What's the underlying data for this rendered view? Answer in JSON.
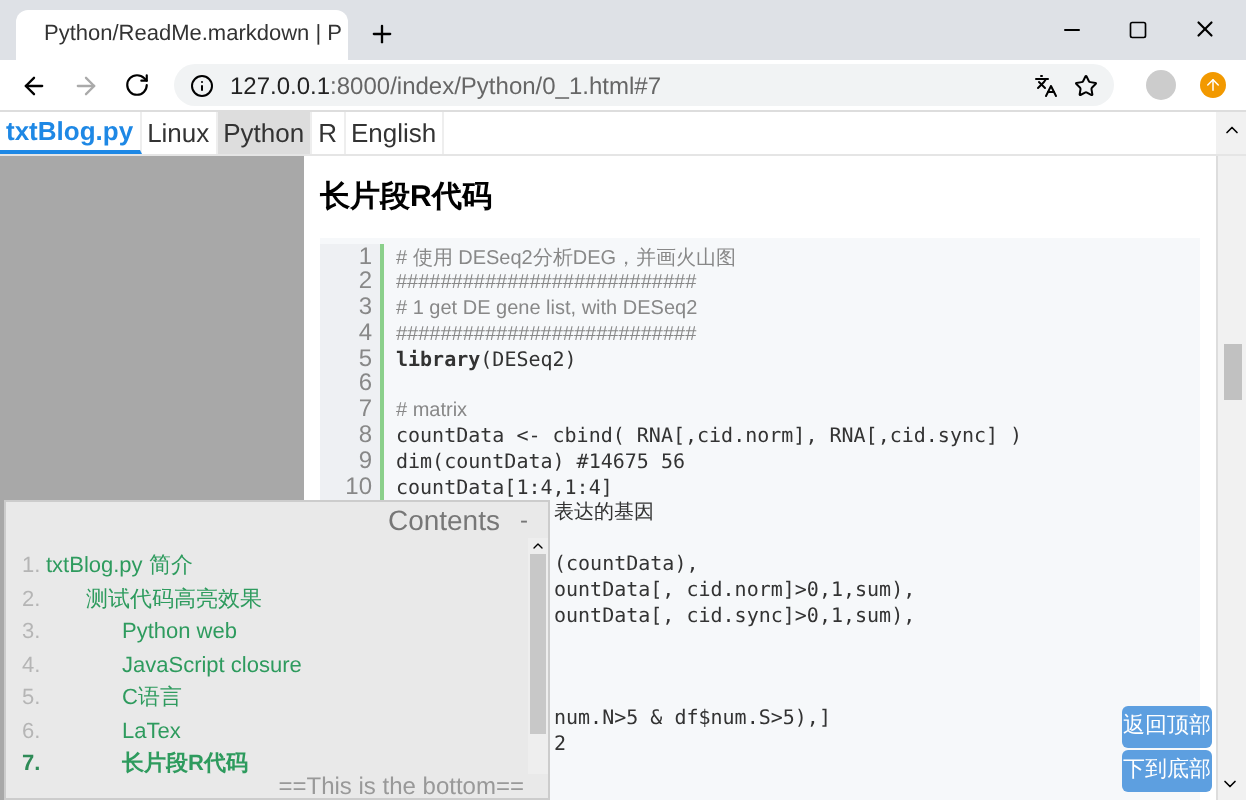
{
  "browser": {
    "tab_title": "Python/ReadMe.markdown | P",
    "url_host": "127.0.0.1",
    "url_rest": ":8000/index/Python/0_1.html#7"
  },
  "nav": [
    {
      "label": "txtBlog.py",
      "kind": "brand",
      "selected": false
    },
    {
      "label": "Linux",
      "kind": "link",
      "selected": false
    },
    {
      "label": "Python",
      "kind": "link",
      "selected": true
    },
    {
      "label": "R",
      "kind": "link",
      "selected": false
    },
    {
      "label": "English",
      "kind": "link",
      "selected": false
    }
  ],
  "heading": "长片段R代码",
  "code": [
    {
      "n": "1",
      "kind": "comment",
      "text": "# 使用 DESeq2分析DEG，并画火山图"
    },
    {
      "n": "2",
      "kind": "comment",
      "text": "###########################"
    },
    {
      "n": "3",
      "kind": "comment",
      "text": "# 1 get DE gene list, with DESeq2"
    },
    {
      "n": "4",
      "kind": "comment",
      "text": "###########################"
    },
    {
      "n": "5",
      "kind": "code",
      "text": "**library**(DESeq2)"
    },
    {
      "n": "6",
      "kind": "blank"
    },
    {
      "n": "7",
      "kind": "comment",
      "text": "# matrix"
    },
    {
      "n": "8",
      "kind": "code",
      "text": "countData <- cbind( RNA[,cid.norm], RNA[,cid.sync] )"
    },
    {
      "n": "9",
      "kind": "code",
      "text": "dim(countData) #14675  56"
    },
    {
      "n": "10",
      "kind": "code",
      "text": "countData[1:4,1:4]"
    },
    {
      "kind": "covered",
      "text": "表达的基因"
    },
    {
      "kind": "covered"
    },
    {
      "kind": "covered",
      "text": "(countData),"
    },
    {
      "kind": "covered",
      "text": "ountData[, cid.norm]>0,1,sum),"
    },
    {
      "kind": "covered",
      "text": "ountData[, cid.sync]>0,1,sum),"
    },
    {
      "kind": "covered"
    },
    {
      "kind": "covered"
    },
    {
      "kind": "covered"
    },
    {
      "kind": "covered",
      "text": "num.N>5 & df$num.S>5),]"
    },
    {
      "kind": "covered",
      "text": "2"
    },
    {
      "kind": "covered"
    }
  ],
  "contents": {
    "title": "Contents",
    "collapse": "-",
    "footer": "==This is the bottom==",
    "items": [
      {
        "number": "1.",
        "label": "txtBlog.py 简介",
        "selected": false,
        "children": [
          {
            "number": "2.",
            "label": "测试代码高亮效果",
            "selected": false,
            "children": [
              {
                "number": "3.",
                "label": "Python web",
                "selected": false
              },
              {
                "number": "4.",
                "label": "JavaScript closure",
                "selected": false
              },
              {
                "number": "5.",
                "label": "C语言",
                "selected": false
              },
              {
                "number": "6.",
                "label": "LaTex",
                "selected": false
              },
              {
                "number": "7.",
                "label": "长片段R代码",
                "selected": true
              }
            ]
          }
        ]
      }
    ]
  },
  "float_buttons": [
    "返回顶部",
    "下到底部"
  ]
}
